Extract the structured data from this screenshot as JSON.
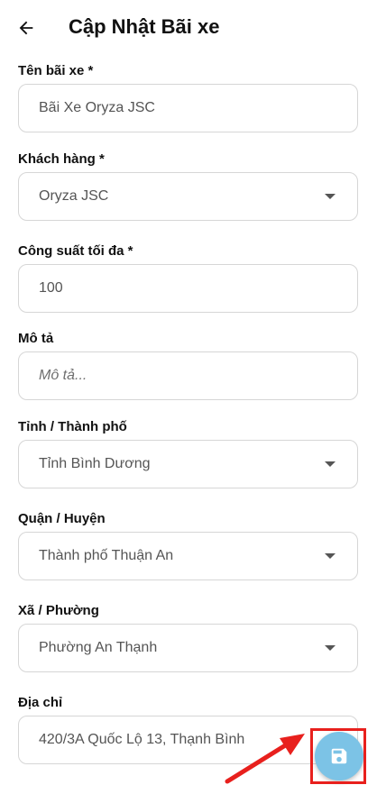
{
  "header": {
    "title": "Cập Nhật Bãi xe"
  },
  "fields": {
    "parking_name": {
      "label": "Tên bãi xe *",
      "value": "Bãi Xe Oryza JSC"
    },
    "customer": {
      "label": "Khách hàng *",
      "value": "Oryza JSC"
    },
    "max_capacity": {
      "label": "Công suất tối đa *",
      "value": "100"
    },
    "description": {
      "label": "Mô tả",
      "placeholder": "Mô tả..."
    },
    "province": {
      "label": "Tỉnh / Thành phố",
      "value": "Tỉnh Bình Dương"
    },
    "district": {
      "label": "Quận / Huyện",
      "value": "Thành phố Thuận An"
    },
    "ward": {
      "label": "Xã / Phường",
      "value": "Phường An Thạnh"
    },
    "address": {
      "label": "Địa chỉ",
      "value": "420/3A Quốc Lộ 13, Thạnh Bình"
    }
  },
  "icons": {
    "back": "arrow-left-icon",
    "dropdown": "caret-down-icon",
    "save": "floppy-disk-icon"
  },
  "colors": {
    "fab_background": "#7cc3e6",
    "highlight": "#e8201d",
    "border": "#d6d6d6"
  }
}
